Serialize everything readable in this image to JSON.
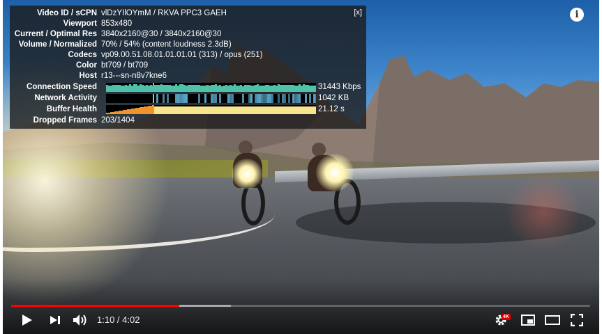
{
  "stats": {
    "close_label": "[x]",
    "rows": [
      {
        "label": "Video ID / sCPN",
        "value": "vlDzYIlOYmM / RKVA PPC3 GAEH"
      },
      {
        "label": "Viewport",
        "value": "853x480"
      },
      {
        "label": "Current / Optimal Res",
        "value": "3840x2160@30 / 3840x2160@30"
      },
      {
        "label": "Volume / Normalized",
        "value": "70% / 54% (content loudness 2.3dB)"
      },
      {
        "label": "Codecs",
        "value": "vp09.00.51.08.01.01.01.01 (313) / opus (251)"
      },
      {
        "label": "Color",
        "value": "bt709 / bt709"
      },
      {
        "label": "Host",
        "value": "r13---sn-n8v7kne6"
      }
    ],
    "graphs": [
      {
        "label": "Connection Speed",
        "value": "31443 Kbps",
        "color": "#4fc1a9"
      },
      {
        "label": "Network Activity",
        "value": "1042 KB",
        "color": "#5aa6c9"
      },
      {
        "label": "Buffer Health",
        "value": "21.12 s",
        "color": "#f6e58d"
      }
    ],
    "dropped": {
      "label": "Dropped Frames",
      "value": "203/1404"
    }
  },
  "player": {
    "time": "1:10 / 4:02",
    "progress_played": 0.29,
    "progress_buffered": 0.38,
    "quality_badge": "4K",
    "colors": {
      "progress": "#ff0000",
      "badge": "#e00000"
    },
    "icons": [
      "play-icon",
      "next-icon",
      "volume-icon",
      "settings-icon",
      "miniplayer-icon",
      "theater-icon",
      "fullscreen-icon",
      "info-icon"
    ]
  }
}
